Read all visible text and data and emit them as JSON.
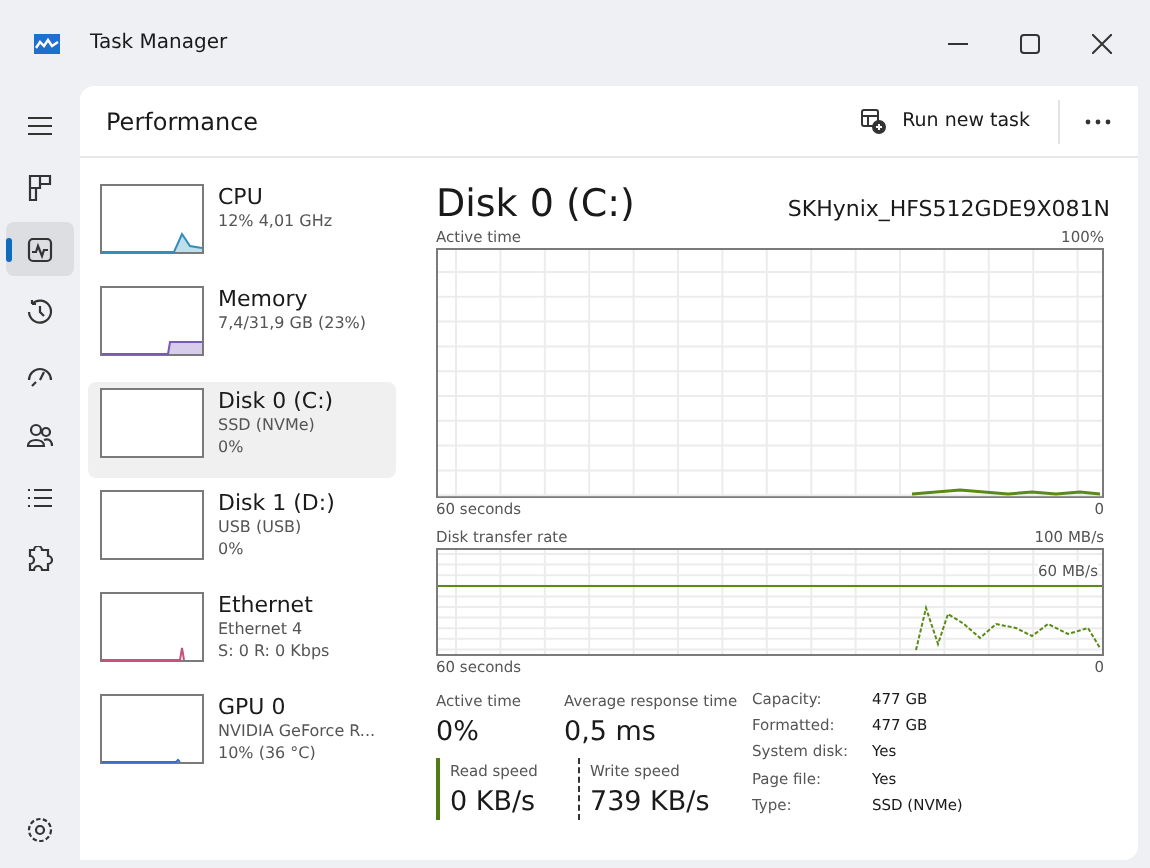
{
  "window": {
    "title": "Task Manager"
  },
  "nav": [
    {
      "kind": "menu",
      "selected": false
    },
    {
      "kind": "processes",
      "selected": false
    },
    {
      "kind": "performance",
      "selected": true
    },
    {
      "kind": "history",
      "selected": false
    },
    {
      "kind": "startup",
      "selected": false
    },
    {
      "kind": "users",
      "selected": false
    },
    {
      "kind": "details",
      "selected": false
    },
    {
      "kind": "services",
      "selected": false
    },
    {
      "kind": "settings",
      "selected": false
    }
  ],
  "page": {
    "title": "Performance",
    "run_button": "Run new task"
  },
  "devices": [
    {
      "kind": "cpu",
      "name": "CPU",
      "details": [
        "12% 4,01 GHz"
      ],
      "selected": false
    },
    {
      "kind": "memory",
      "name": "Memory",
      "details": [
        "7,4/31,9 GB (23%)"
      ],
      "selected": false
    },
    {
      "kind": "disk",
      "name": "Disk 0 (C:)",
      "details": [
        "SSD (NVMe)",
        "0%"
      ],
      "selected": true
    },
    {
      "kind": "disk",
      "name": "Disk 1 (D:)",
      "details": [
        "USB (USB)",
        "0%"
      ],
      "selected": false
    },
    {
      "kind": "network",
      "name": "Ethernet",
      "details": [
        "Ethernet 4",
        "S: 0 R: 0 Kbps"
      ],
      "selected": false
    },
    {
      "kind": "gpu",
      "name": "GPU 0",
      "details": [
        "NVIDIA GeForce R...",
        "10%  (36 °C)"
      ],
      "selected": false
    }
  ],
  "detail": {
    "title": "Disk 0 (C:)",
    "model": "SKHynix_HFS512GDE9X081N",
    "active_chart": {
      "label": "Active time",
      "max": "100%",
      "span": "60 seconds",
      "min": "0"
    },
    "transfer_chart": {
      "label": "Disk transfer rate",
      "max": "100 MB/s",
      "marker": "60 MB/s",
      "span": "60 seconds",
      "min": "0"
    },
    "stats": [
      {
        "label": "Active time",
        "value": "0%"
      },
      {
        "label": "Average response time",
        "value": "0,5 ms"
      }
    ],
    "speeds": [
      {
        "kind": "read",
        "label": "Read speed",
        "value": "0 KB/s"
      },
      {
        "kind": "write",
        "label": "Write speed",
        "value": "739 KB/s"
      }
    ],
    "properties": [
      {
        "label": "Capacity:",
        "value": "477 GB"
      },
      {
        "label": "Formatted:",
        "value": "477 GB"
      },
      {
        "label": "System disk:",
        "value": "Yes"
      },
      {
        "label": "Page file:",
        "value": "Yes"
      },
      {
        "label": "Type:",
        "value": "SSD (NVMe)"
      }
    ]
  }
}
